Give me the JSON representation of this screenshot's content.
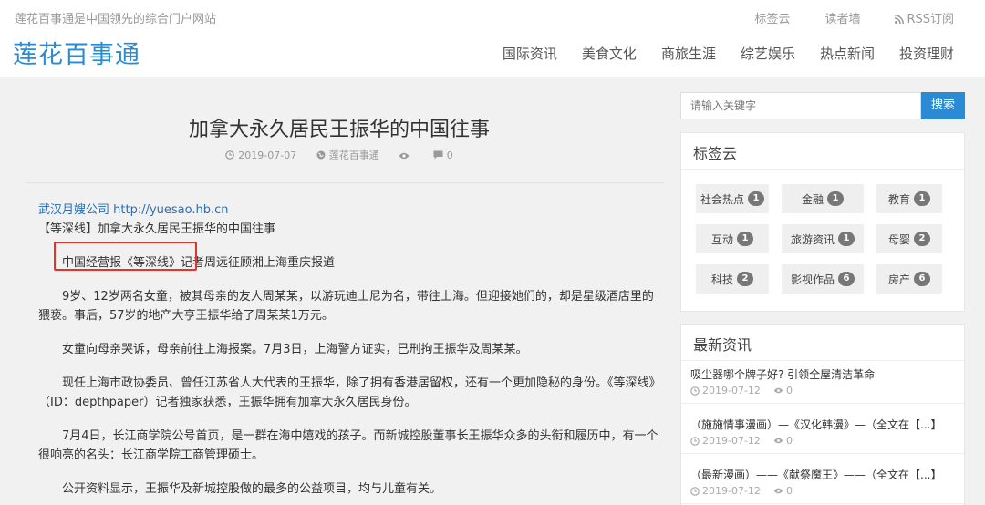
{
  "header": {
    "tagline": "莲花百事通是中国领先的综合门户网站",
    "links": [
      "标签云",
      "读者墙",
      "RSS订阅"
    ],
    "logo": "莲花百事通",
    "nav": [
      "国际资讯",
      "美食文化",
      "商旅生涯",
      "综艺娱乐",
      "热点新闻",
      "投资理财"
    ]
  },
  "article": {
    "title": "加拿大永久居民王振华的中国往事",
    "date": "2019-07-07",
    "site": "莲花百事通",
    "comments": "0",
    "source_name": "武汉月嫂公司",
    "source_url": "http://yuesao.hb.cn",
    "lead": "【等深线】加拿大永久居民王振华的中国往事",
    "highlight": "中国经营报《等深线》",
    "byline_rest": "记者周远征顾湘上海重庆报道",
    "paragraphs": [
      "9岁、12岁两名女童，被其母亲的友人周某某，以游玩迪士尼为名，带往上海。但迎接她们的，却是星级酒店里的猥亵。事后，57岁的地产大亨王振华给了周某某1万元。",
      "女童向母亲哭诉，母亲前往上海报案。7月3日，上海警方证实，已刑拘王振华及周某某。",
      "现任上海市政协委员、曾任江苏省人大代表的王振华，除了拥有香港居留权，还有一个更加隐秘的身份。《等深线》（ID：depthpaper）记者独家获悉，王振华拥有加拿大永久居民身份。",
      "7月4日，长江商学院公号首页，是一群在海中嬉戏的孩子。而新城控股董事长王振华众多的头衔和履历中，有一个很响亮的名头：长江商学院工商管理硕士。",
      "公开资料显示，王振华及新城控股做的最多的公益项目，均与儿童有关。"
    ]
  },
  "sidebar": {
    "search_placeholder": "请输入关键字",
    "search_button": "搜索",
    "tagcloud_title": "标签云",
    "tags": [
      {
        "name": "社会热点",
        "count": "1"
      },
      {
        "name": "金融",
        "count": "1"
      },
      {
        "name": "教育",
        "count": "1"
      },
      {
        "name": "互动",
        "count": "1"
      },
      {
        "name": "旅游资讯",
        "count": "1"
      },
      {
        "name": "母婴",
        "count": "2"
      },
      {
        "name": "科技",
        "count": "2"
      },
      {
        "name": "影视作品",
        "count": "6"
      },
      {
        "name": "房产",
        "count": "6"
      }
    ],
    "latest_title": "最新资讯",
    "latest": [
      {
        "title": "吸尘器哪个牌子好? 引领全屋清洁革命",
        "date": "2019-07-12",
        "views": "0"
      },
      {
        "title": "（施施情事漫画）—《汉化韩漫》—（全文在【...】",
        "date": "2019-07-12",
        "views": "0"
      },
      {
        "title": "（最新漫画）——《献祭魔王》——（全文在【...】",
        "date": "2019-07-12",
        "views": "0"
      }
    ]
  },
  "colors": {
    "accent": "#2a8ad4",
    "highlight_box": "#e5332a"
  }
}
